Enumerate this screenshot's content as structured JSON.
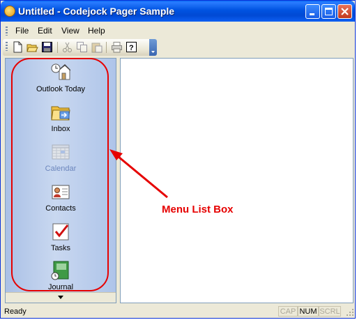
{
  "window": {
    "title": "Untitled - Codejock Pager Sample"
  },
  "menubar": {
    "items": [
      "File",
      "Edit",
      "View",
      "Help"
    ]
  },
  "toolbar": {
    "buttons": [
      "new-icon",
      "open-icon",
      "save-icon",
      "cut-icon",
      "copy-icon",
      "paste-icon",
      "print-icon",
      "help-icon"
    ]
  },
  "sidebar": {
    "items": [
      {
        "label": "Outlook Today",
        "icon": "outlook-today-icon",
        "enabled": true
      },
      {
        "label": "Inbox",
        "icon": "inbox-icon",
        "enabled": true
      },
      {
        "label": "Calendar",
        "icon": "calendar-icon",
        "enabled": false
      },
      {
        "label": "Contacts",
        "icon": "contacts-icon",
        "enabled": true
      },
      {
        "label": "Tasks",
        "icon": "tasks-icon",
        "enabled": true
      },
      {
        "label": "Journal",
        "icon": "journal-icon",
        "enabled": true
      }
    ]
  },
  "statusbar": {
    "text": "Ready",
    "indicators": [
      {
        "label": "CAP",
        "active": false
      },
      {
        "label": "NUM",
        "active": true
      },
      {
        "label": "SCRL",
        "active": false
      }
    ]
  },
  "annotation": {
    "label": "Menu List Box",
    "color": "#e60000"
  }
}
